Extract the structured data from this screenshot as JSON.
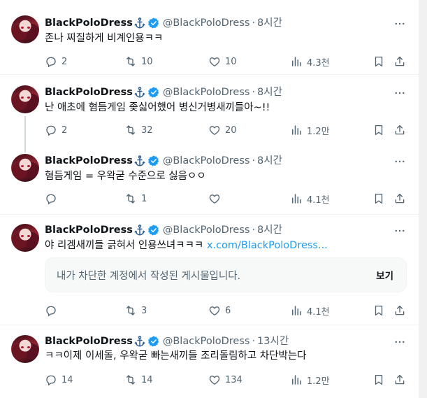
{
  "icons": {
    "reply": "reply-icon",
    "retweet": "retweet-icon",
    "like": "like-icon",
    "views": "views-icon",
    "bookmark": "bookmark-icon",
    "share": "share-icon",
    "more": "more-icon",
    "anchor": "anchor-icon",
    "verified": "verified-badge-icon"
  },
  "colors": {
    "verified": "#1d9bf0",
    "link": "#1d9bf0",
    "muted": "#536471"
  },
  "blocked_notice": {
    "text": "내가 차단한 계정에서 작성된 게시물입니다.",
    "view_label": "보기"
  },
  "tweets": [
    {
      "name": "BlackPoloDress",
      "handle": "@BlackPoloDress",
      "separator": "·",
      "time": "8시간",
      "text": "존나 찌질하게 비계인용ㅋㅋ",
      "link": "",
      "replies": "2",
      "retweets": "10",
      "likes": "10",
      "views": "4.3천"
    },
    {
      "name": "BlackPoloDress",
      "handle": "@BlackPoloDress",
      "separator": "·",
      "time": "8시간",
      "text": "난 애초에 혐듬게임 좆싫어했어 병신거병새끼들아~!!",
      "link": "",
      "replies": "2",
      "retweets": "32",
      "likes": "20",
      "views": "1.2만"
    },
    {
      "name": "BlackPoloDress",
      "handle": "@BlackPoloDress",
      "separator": "·",
      "time": "8시간",
      "text": "혐듬게임 = 우왁굳 수준으로 싫음ㅇㅇ",
      "link": "",
      "replies": "",
      "retweets": "1",
      "likes": "",
      "views": "4.1천"
    },
    {
      "name": "BlackPoloDress",
      "handle": "@BlackPoloDress",
      "separator": "·",
      "time": "8시간",
      "text": "야 리겜새끼들 긁혀서 인용쓰녀ㅋㅋㅋ ",
      "link": "x.com/BlackPoloDress...",
      "replies": "",
      "retweets": "3",
      "likes": "6",
      "views": "4.1천"
    },
    {
      "name": "BlackPoloDress",
      "handle": "@BlackPoloDress",
      "separator": "·",
      "time": "13시간",
      "text": "ㅋㅋ이제 이세돌, 우왁굳 빠는새끼들 조리돌림하고 차단박는다",
      "link": "",
      "replies": "14",
      "retweets": "14",
      "likes": "134",
      "views": "1.2만"
    }
  ]
}
